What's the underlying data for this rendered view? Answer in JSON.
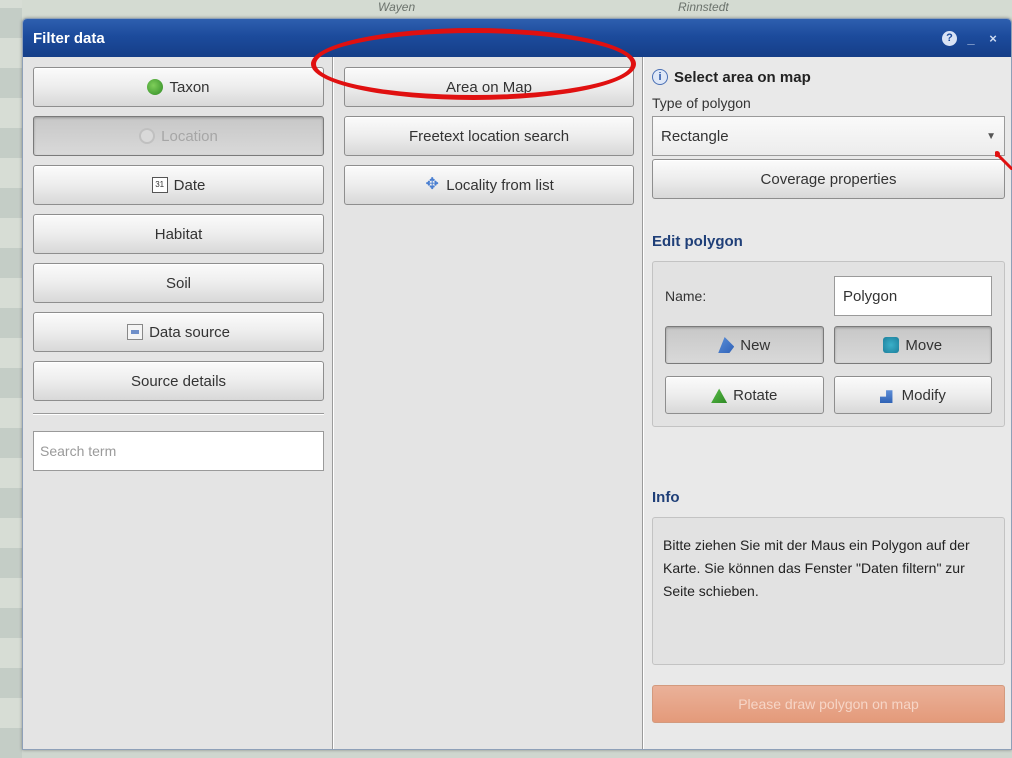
{
  "map": {
    "top_labels": [
      "Wayen",
      "Rinnstedt"
    ]
  },
  "window": {
    "title": "Filter data",
    "help_icon": "help-icon",
    "minimize_icon": "minimize-icon",
    "close_icon": "close-icon"
  },
  "left": {
    "buttons": [
      {
        "label": "Taxon",
        "icon": "taxon-icon"
      },
      {
        "label": "Location",
        "icon": "location-icon"
      },
      {
        "label": "Date",
        "icon": "calendar-icon"
      },
      {
        "label": "Habitat"
      },
      {
        "label": "Soil"
      },
      {
        "label": "Data source",
        "icon": "document-icon"
      },
      {
        "label": "Source details"
      }
    ],
    "date_icon_text": "31",
    "search": {
      "placeholder": "Search term",
      "value": ""
    }
  },
  "middle": {
    "buttons": [
      {
        "label": "Area on Map"
      },
      {
        "label": "Freetext location search"
      },
      {
        "label": "Locality from list",
        "icon": "locality-icon"
      }
    ]
  },
  "right": {
    "heading": "Select area on map",
    "info_icon_text": "i",
    "polygon_type_label": "Type of polygon",
    "polygon_type_value": "Rectangle",
    "coverage_button": "Coverage properties",
    "edit_heading": "Edit polygon",
    "name_label": "Name:",
    "name_value": "Polygon",
    "actions": [
      {
        "label": "New",
        "icon": "new-icon"
      },
      {
        "label": "Move",
        "icon": "move-icon"
      },
      {
        "label": "Rotate",
        "icon": "rotate-icon"
      },
      {
        "label": "Modify",
        "icon": "modify-icon"
      }
    ],
    "info_heading": "Info",
    "info_text": "Bitte ziehen Sie mit der Maus ein Polygon auf der Karte. Sie können das Fenster \"Daten filtern\" zur Seite schieben.",
    "draw_button": "Please draw polygon on map"
  },
  "colors": {
    "titlebar": "#1c4b9c",
    "annotation": "#e01010",
    "draw_button": "#e49a7a"
  }
}
